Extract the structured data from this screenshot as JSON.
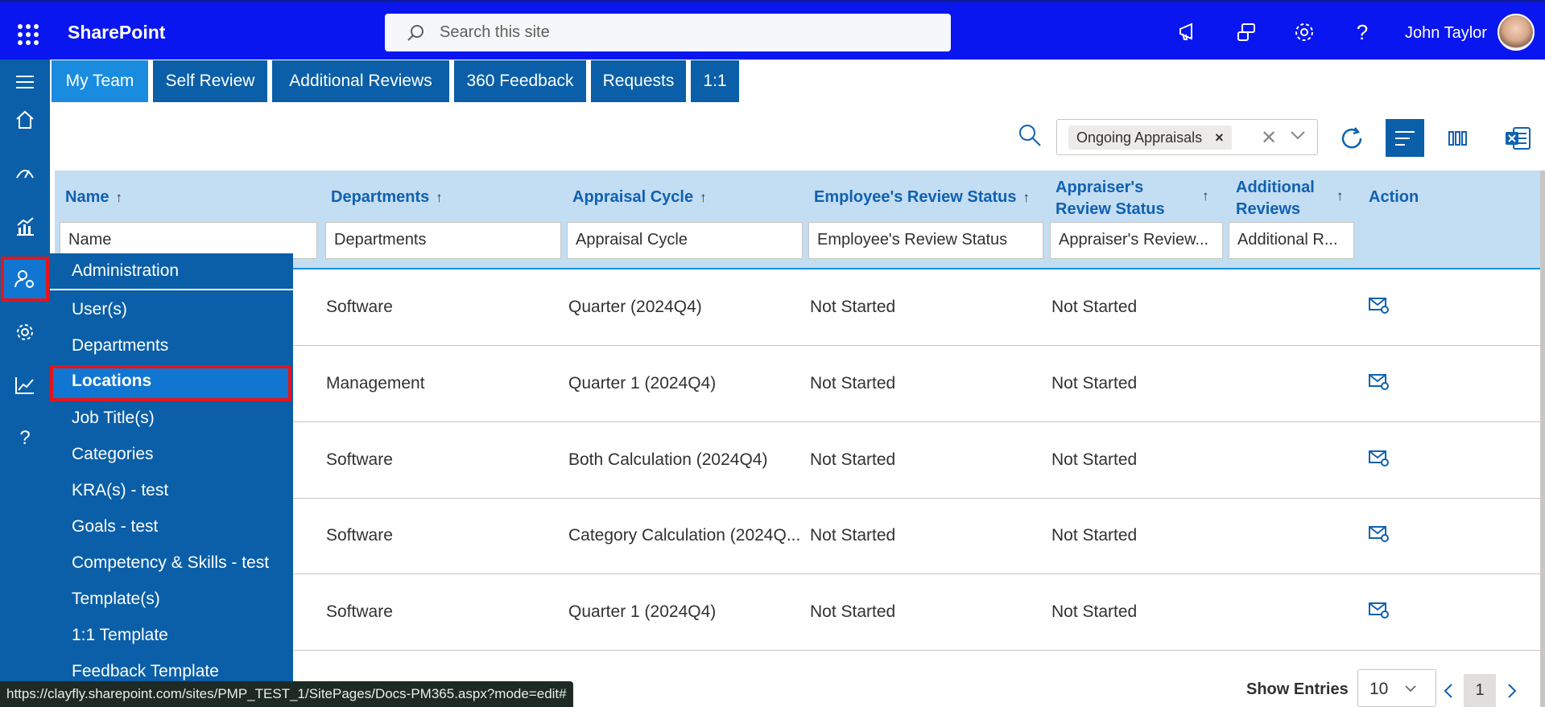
{
  "app": {
    "title": "SharePoint",
    "user_name": "John Taylor"
  },
  "search": {
    "placeholder": "Search this site"
  },
  "topbar_icons": [
    "megaphone-icon",
    "teams-icon",
    "gear-icon",
    "help-icon"
  ],
  "tabs": [
    {
      "label": "My Team",
      "active": true
    },
    {
      "label": "Self Review"
    },
    {
      "label": "Additional Reviews"
    },
    {
      "label": "360 Feedback"
    },
    {
      "label": "Requests"
    },
    {
      "label": "1:1"
    }
  ],
  "filter": {
    "chip": "Ongoing Appraisals",
    "chip_remove": "×",
    "clear": "✕"
  },
  "columns": [
    {
      "label": "Name",
      "arrow": "↑",
      "filter": "Name"
    },
    {
      "label": "Departments",
      "arrow": "↑",
      "filter": "Departments"
    },
    {
      "label": "Appraisal Cycle",
      "arrow": "↑",
      "filter": "Appraisal Cycle"
    },
    {
      "label": "Employee's Review Status",
      "arrow": "↑",
      "filter": "Employee's Review Status"
    },
    {
      "label_1": "Appraiser's",
      "label_2": "Review Status",
      "arrow": "↑",
      "filter": "Appraiser's Review..."
    },
    {
      "label_1": "Additional",
      "label_2": "Reviews",
      "arrow": "↑",
      "filter": "Additional R..."
    },
    {
      "label": "Action"
    }
  ],
  "rows": [
    {
      "department": "Software",
      "cycle": "Quarter (2024Q4)",
      "employee_status": "Not Started",
      "appraiser_status": "Not Started"
    },
    {
      "department": "Management",
      "cycle": "Quarter 1 (2024Q4)",
      "employee_status": "Not Started",
      "appraiser_status": "Not Started"
    },
    {
      "department": "Software",
      "cycle": "Both Calculation (2024Q4)",
      "employee_status": "Not Started",
      "appraiser_status": "Not Started"
    },
    {
      "department": "Software",
      "cycle": "Category Calculation (2024Q...",
      "employee_status": "Not Started",
      "appraiser_status": "Not Started"
    },
    {
      "department": "Software",
      "cycle": "Quarter 1 (2024Q4)",
      "employee_status": "Not Started",
      "appraiser_status": "Not Started"
    }
  ],
  "menu": {
    "title": "Administration",
    "items": [
      "User(s)",
      "Departments",
      "Locations",
      "Job Title(s)",
      "Categories",
      "KRA(s) - test",
      "Goals - test",
      "Competency & Skills - test",
      "Template(s)",
      "1:1 Template",
      "Feedback Template"
    ],
    "selected": "Locations"
  },
  "footer": {
    "show_entries": "Show Entries",
    "page_size": "10",
    "current_page": "1"
  },
  "status_url": "https://clayfly.sharepoint.com/sites/PMP_TEST_1/SitePages/Docs-PM365.aspx?mode=edit#",
  "colors": {
    "topbar": "#0a16f0",
    "rail": "#0a5fa8",
    "accent": "#1a8ce0",
    "header_bg": "#c3ddf2",
    "highlight": "#e3151c"
  }
}
